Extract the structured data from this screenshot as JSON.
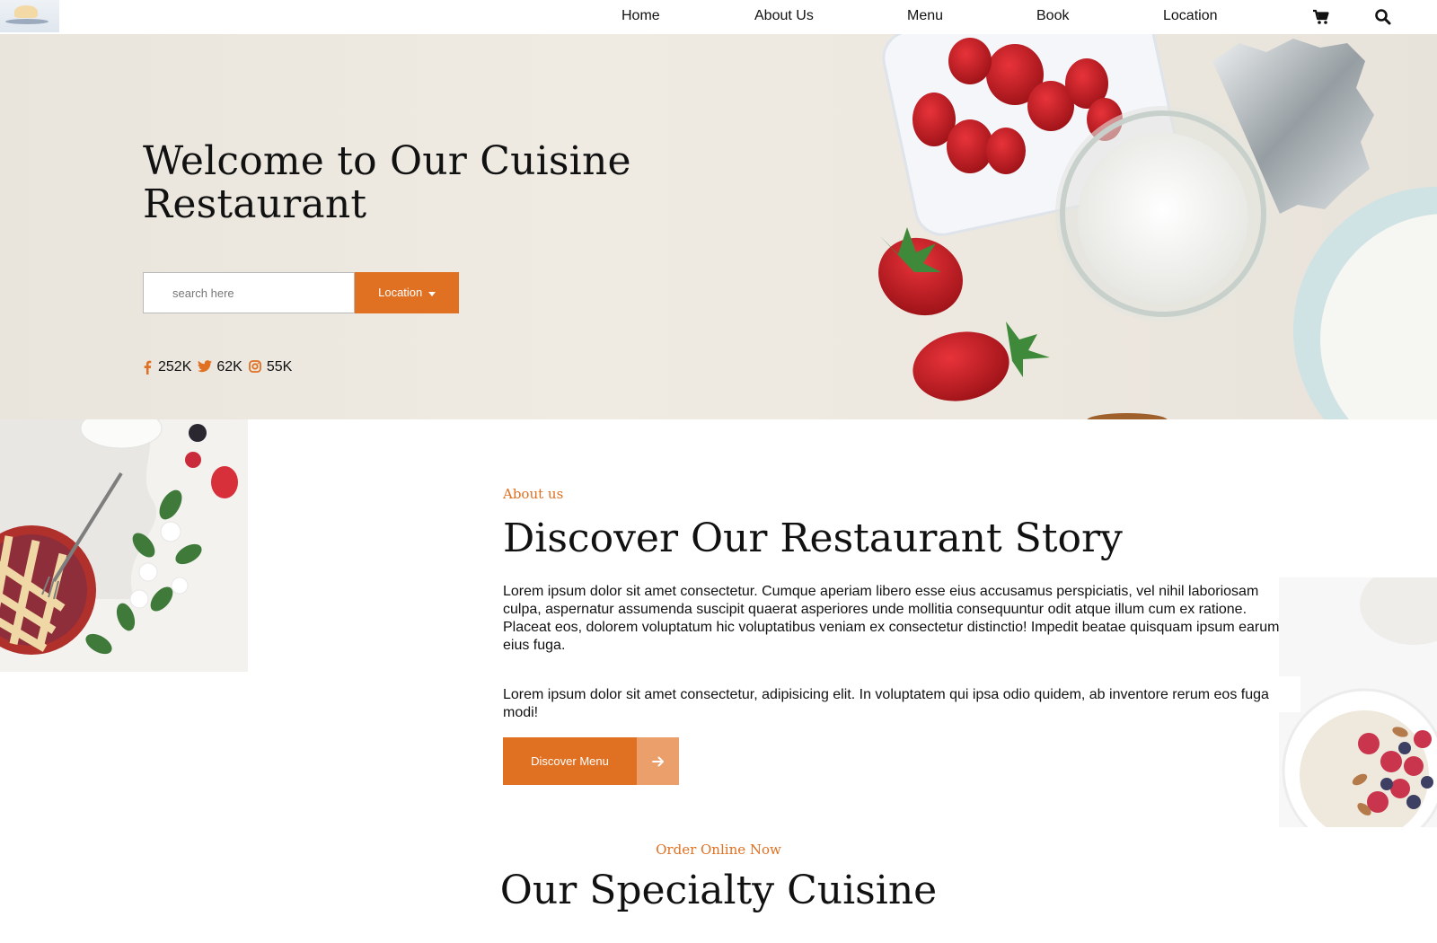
{
  "nav": {
    "items": [
      {
        "label": "Home"
      },
      {
        "label": "About Us"
      },
      {
        "label": "Menu"
      },
      {
        "label": "Book"
      },
      {
        "label": "Location"
      }
    ],
    "cart_icon": "cart-icon",
    "search_icon": "search-icon"
  },
  "hero": {
    "title": "Welcome to Our Cuisine Restaurant",
    "search_placeholder": "search here",
    "location_button": "Location",
    "social": [
      {
        "icon": "facebook-icon",
        "count": "252K"
      },
      {
        "icon": "twitter-icon",
        "count": "62K"
      },
      {
        "icon": "instagram-icon",
        "count": "55K"
      }
    ]
  },
  "about": {
    "eyebrow": "About us",
    "title": "Discover Our Restaurant Story",
    "paragraph1": "Lorem ipsum dolor sit amet consectetur. Cumque aperiam libero esse eius accusamus perspiciatis, vel nihil laboriosam culpa, aspernatur assumenda suscipit quaerat asperiores unde mollitia consequuntur odit atque illum cum ex ratione. Placeat eos, dolorem voluptatum hic voluptatibus veniam ex consectetur distinctio! Impedit beatae quisquam ipsum earum eius fuga.",
    "paragraph2": "Lorem ipsum dolor sit amet consectetur, adipisicing elit. In voluptatem qui ipsa odio quidem, ab inventore rerum eos fuga modi!",
    "cta_label": "Discover Menu"
  },
  "specialty": {
    "eyebrow": "Order Online Now",
    "title": "Our Specialty Cuisine"
  },
  "colors": {
    "accent": "#e07022",
    "accent_light": "#eba06b"
  }
}
